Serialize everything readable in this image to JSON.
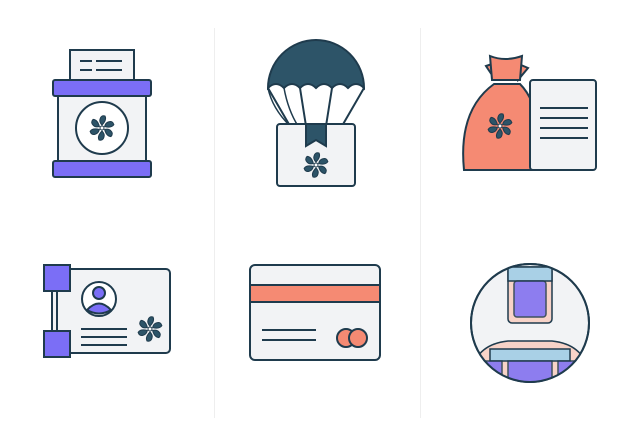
{
  "colors": {
    "outline": "#1f3b4d",
    "navy": "#2d5468",
    "purple": "#7b6ef6",
    "salmon": "#f58a73",
    "light": "#f2f3f5",
    "peach": "#f7d3c8",
    "lightblue": "#a9d0e6",
    "white": "#ffffff"
  },
  "icons": [
    {
      "name": "jar-document-icon"
    },
    {
      "name": "parachute-box-icon"
    },
    {
      "name": "money-bag-document-icon"
    },
    {
      "name": "id-card-icon"
    },
    {
      "name": "credit-card-icon"
    },
    {
      "name": "user-avatar-icon"
    }
  ]
}
